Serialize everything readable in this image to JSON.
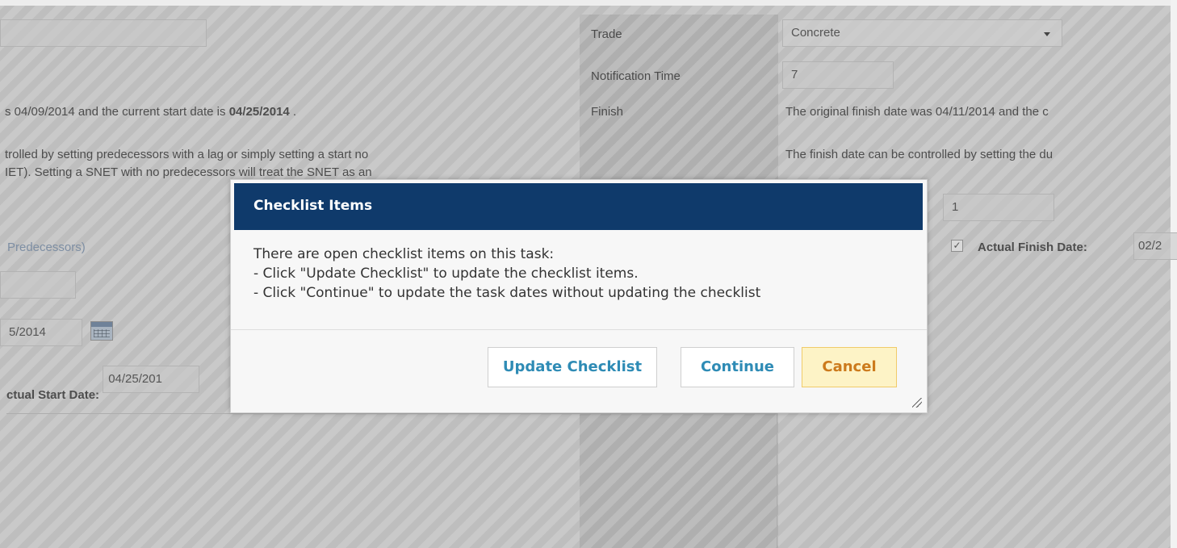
{
  "form": {
    "trade_label": "Trade",
    "trade_value": "Concrete",
    "notification_label": "Notification Time",
    "notification_value": "7",
    "finish_label": "Finish",
    "start_text_prefix": "s 04/09/2014 and the current start date is ",
    "start_text_date": "04/25/2014",
    "start_text_suffix": " .",
    "start_help_line1": "trolled by setting predecessors with a lag or simply setting a start no",
    "start_help_line2": "IET). Setting a SNET with no predecessors will treat the SNET as an",
    "predecessors_link": "Predecessors)",
    "start_date_value": "5/2014",
    "actual_start_label": "ctual Start Date:",
    "actual_start_value": "04/25/201",
    "finish_text": "The original finish date was 04/11/2014 and the c",
    "finish_help": "The finish date can be controlled by setting the du",
    "duration_value": "1",
    "actual_finish_label": "Actual Finish Date:",
    "actual_finish_value": "02/2",
    "checkbox_mark": "✓"
  },
  "dialog": {
    "title": "Checklist Items",
    "message_lines": [
      "There are open checklist items on this task:",
      "- Click \"Update Checklist\" to update the checklist items.",
      "- Click \"Continue\" to update the task dates without updating the checklist"
    ],
    "buttons": {
      "update_checklist": "Update Checklist",
      "continue": "Continue",
      "cancel": "Cancel"
    }
  },
  "colors": {
    "dialog_header": "#0f3a6b",
    "button_text": "#2e8bb5",
    "cancel_bg": "#fdf3c6",
    "cancel_text": "#cc7a1c"
  }
}
